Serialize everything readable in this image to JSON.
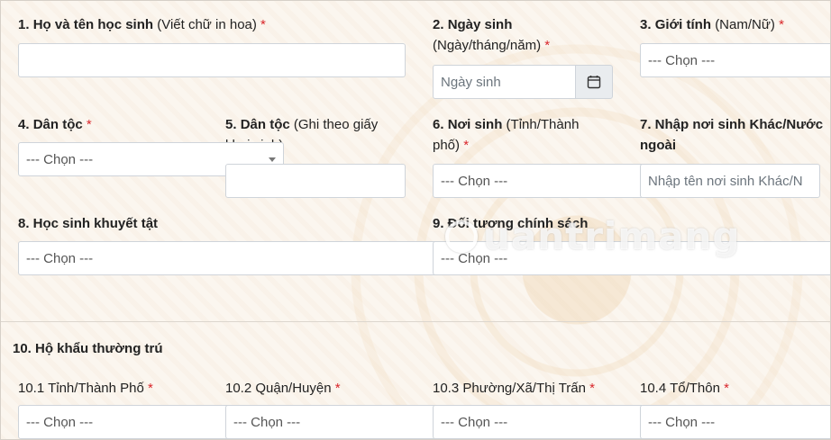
{
  "fields": {
    "f1": {
      "num": "1.",
      "title": "Họ và tên học sinh",
      "hint": "(Viết chữ in hoa)",
      "required": "*"
    },
    "f2": {
      "num": "2.",
      "title": "Ngày sinh",
      "hint": "(Ngày/tháng/năm)",
      "required": "*",
      "placeholder": "Ngày sinh"
    },
    "f3": {
      "num": "3.",
      "title": "Giới tính",
      "hint": "(Nam/Nữ)",
      "required": "*",
      "value": "--- Chọn ---"
    },
    "f4": {
      "num": "4.",
      "title": "Dân tộc",
      "required": "*",
      "value": "--- Chọn ---"
    },
    "f5": {
      "num": "5.",
      "title": "Dân tộc",
      "hint_line1": "(Ghi theo giấy",
      "hint_line2": "khai sinh)"
    },
    "f6": {
      "num": "6.",
      "title": "Nơi sinh",
      "hint_line1": "(Tỉnh/Thành",
      "hint_line2": "phố)",
      "required": "*",
      "value": "--- Chọn ---"
    },
    "f7": {
      "line1": "7. Nhập nơi sinh Khác/Nước",
      "line2": "ngoài",
      "placeholder": "Nhập tên nơi sinh Khác/N"
    },
    "f8": {
      "title": "8. Học sinh khuyết tật",
      "value": "--- Chọn ---"
    },
    "f9": {
      "title": "9. Đối tượng chính sách",
      "value": "--- Chọn ---"
    },
    "f10": {
      "title": "10. Hộ khẩu thường trú"
    },
    "f10_1": {
      "title": "10.1 Tỉnh/Thành Phố",
      "required": "*",
      "value": "--- Chọn ---"
    },
    "f10_2": {
      "title": "10.2 Quận/Huyện",
      "required": "*",
      "value": "--- Chọn ---"
    },
    "f10_3": {
      "title": "10.3 Phường/Xã/Thị Trấn",
      "required": "*",
      "value": "--- Chọn ---"
    },
    "f10_4": {
      "title": "10.4 Tổ/Thôn",
      "required": "*",
      "value": "--- Chọn ---"
    }
  },
  "watermark": "uantrimang",
  "icons": {
    "calendar": "calendar-icon",
    "dropdown": "chevron-down-icon",
    "logo": "quantrimang-logo"
  }
}
